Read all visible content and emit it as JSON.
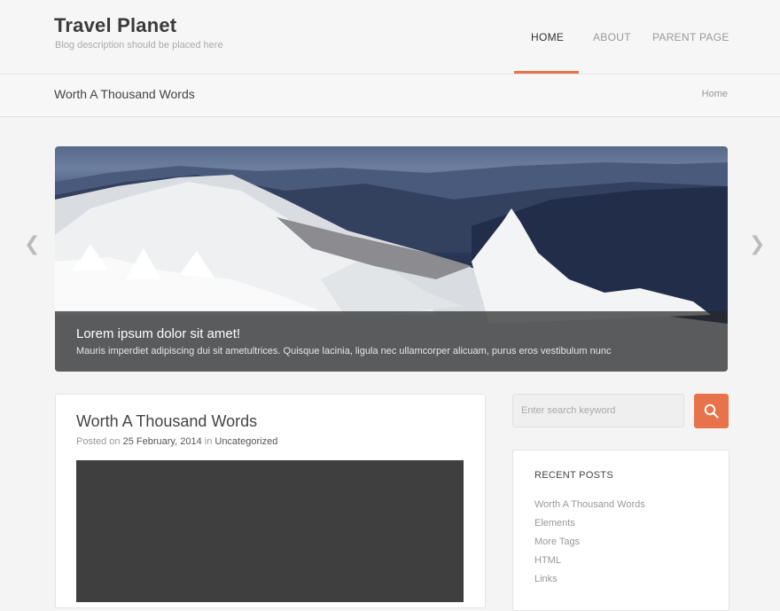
{
  "site": {
    "title": "Travel Planet",
    "description": "Blog description should be placed here"
  },
  "nav": {
    "items": [
      "HOME",
      "ABOUT",
      "PARENT PAGE"
    ],
    "active": "HOME",
    "accent_color": "#e8734a"
  },
  "titlebar": {
    "page_title": "Worth A Thousand Words",
    "breadcrumb": "Home"
  },
  "slider": {
    "caption_title": "Lorem ipsum dolor sit amet!",
    "caption_text": "Mauris imperdiet adipiscing dui sit ametultrices. Quisque lacinia, ligula nec ullamcorper alicuam, purus eros vestibulum nunc",
    "prev_icon": "chevron-left-icon",
    "next_icon": "chevron-right-icon"
  },
  "post": {
    "title": "Worth A Thousand Words",
    "posted_on_label": "Posted on",
    "date": "25 February, 2014",
    "in_label": "in",
    "category": "Uncategorized"
  },
  "sidebar": {
    "search_placeholder": "Enter search keyword",
    "search_icon": "search-icon",
    "recent_posts_title": "RECENT POSTS",
    "recent_posts": [
      "Worth A Thousand Words",
      "Elements",
      "More Tags",
      "HTML",
      "Links"
    ]
  }
}
